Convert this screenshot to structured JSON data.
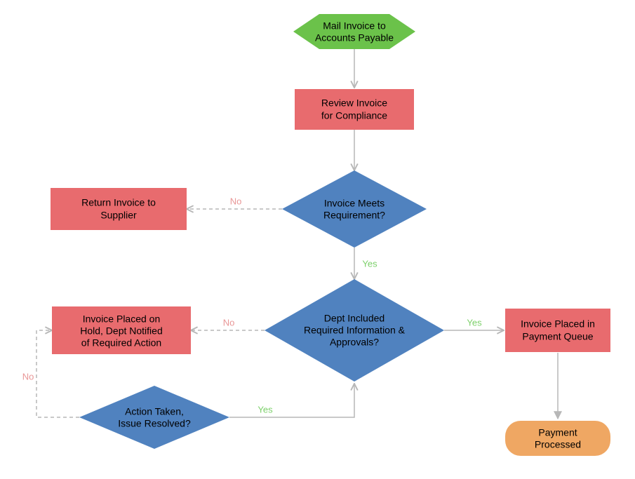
{
  "nodes": {
    "start": {
      "label": [
        "Mail Invoice to",
        "Accounts Payable"
      ]
    },
    "review": {
      "label": [
        "Review Invoice",
        "for Compliance"
      ]
    },
    "meets": {
      "label": [
        "Invoice Meets",
        "Requirement?"
      ]
    },
    "return": {
      "label": [
        "Return Invoice to",
        "Supplier"
      ]
    },
    "dept": {
      "label": [
        "Dept Included",
        "Required Information &",
        "Approvals?"
      ]
    },
    "hold": {
      "label": [
        "Invoice Placed on",
        "Hold, Dept Notified",
        "of Required Action"
      ]
    },
    "action": {
      "label": [
        "Action Taken,",
        "Issue Resolved?"
      ]
    },
    "queue": {
      "label": [
        "Invoice Placed in",
        "Payment Queue"
      ]
    },
    "processed": {
      "label": [
        "Payment",
        "Processed"
      ]
    }
  },
  "edges": {
    "meets_no": "No",
    "meets_yes": "Yes",
    "dept_no": "No",
    "dept_yes": "Yes",
    "action_yes": "Yes",
    "action_no": "No"
  },
  "colors": {
    "green": "#6bc24a",
    "red": "#e86b6e",
    "blue": "#5082bf",
    "orange": "#efa763",
    "arrow": "#b7b7b7"
  }
}
